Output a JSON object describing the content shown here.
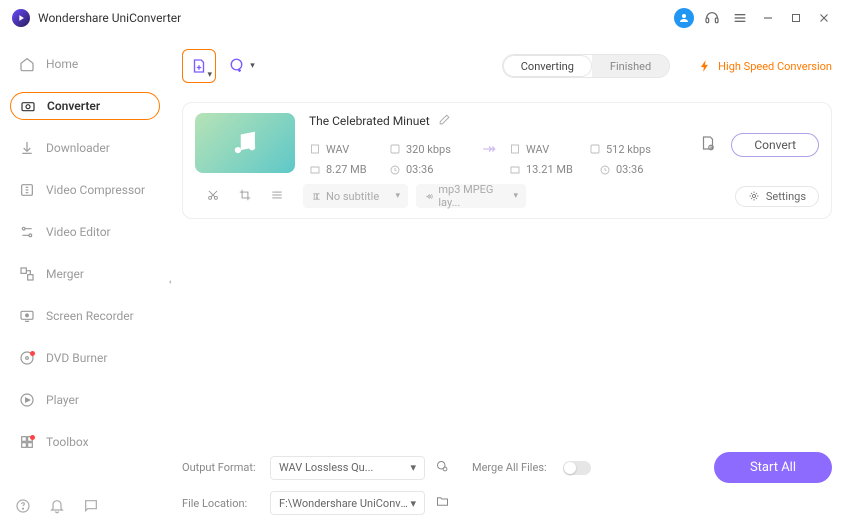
{
  "app": {
    "title": "Wondershare UniConverter"
  },
  "titleIcons": {
    "user": "user-icon",
    "support": "headset-icon",
    "menu": "menu-icon",
    "min": "minimize-icon",
    "max": "maximize-icon",
    "close": "close-icon"
  },
  "sidebar": {
    "items": [
      {
        "label": "Home",
        "icon": "home-icon"
      },
      {
        "label": "Converter",
        "icon": "converter-icon",
        "active": true
      },
      {
        "label": "Downloader",
        "icon": "downloader-icon"
      },
      {
        "label": "Video Compressor",
        "icon": "compressor-icon"
      },
      {
        "label": "Video Editor",
        "icon": "editor-icon"
      },
      {
        "label": "Merger",
        "icon": "merger-icon"
      },
      {
        "label": "Screen Recorder",
        "icon": "recorder-icon"
      },
      {
        "label": "DVD Burner",
        "icon": "dvd-icon",
        "dot": true
      },
      {
        "label": "Player",
        "icon": "player-icon"
      },
      {
        "label": "Toolbox",
        "icon": "toolbox-icon",
        "dot": true
      }
    ]
  },
  "tabs": {
    "converting": "Converting",
    "finished": "Finished"
  },
  "highspeed": "High Speed Conversion",
  "file": {
    "title": "The Celebrated Minuet",
    "src": {
      "format": "WAV",
      "bitrate": "320 kbps",
      "size": "8.27 MB",
      "duration": "03:36"
    },
    "dst": {
      "format": "WAV",
      "bitrate": "512 kbps",
      "size": "13.21 MB",
      "duration": "03:36"
    },
    "convertLabel": "Convert",
    "subtitle": "No subtitle",
    "audiotrack": "mp3 MPEG lay...",
    "settingsLabel": "Settings"
  },
  "footer": {
    "outputFormatLabel": "Output Format:",
    "outputFormatValue": "WAV Lossless Qu...",
    "fileLocationLabel": "File Location:",
    "fileLocationValue": "F:\\Wondershare UniConverter",
    "mergeLabel": "Merge All Files:",
    "startAll": "Start All"
  }
}
